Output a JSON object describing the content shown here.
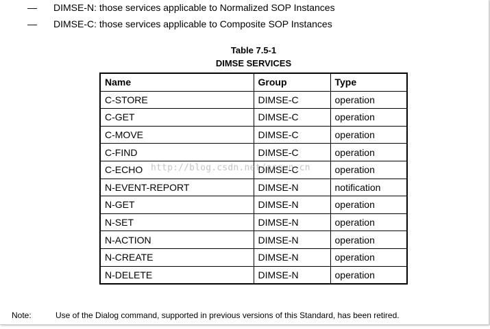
{
  "bullets": [
    {
      "dash": "—",
      "text": "DIMSE-N: those services applicable to Normalized SOP Instances"
    },
    {
      "dash": "—",
      "text": "DIMSE-C: those services applicable to Composite SOP Instances"
    }
  ],
  "table": {
    "caption_line1": "Table 7.5-1",
    "caption_line2": "DIMSE SERVICES",
    "headers": [
      "Name",
      "Group",
      "Type"
    ],
    "rows": [
      [
        "C-STORE",
        "DIMSE-C",
        "operation"
      ],
      [
        "C-GET",
        "DIMSE-C",
        "operation"
      ],
      [
        "C-MOVE",
        "DIMSE-C",
        "operation"
      ],
      [
        "C-FIND",
        "DIMSE-C",
        "operation"
      ],
      [
        "C-ECHO",
        "DIMSE-C",
        "operation"
      ],
      [
        "N-EVENT-REPORT",
        "DIMSE-N",
        "notification"
      ],
      [
        "N-GET",
        "DIMSE-N",
        "operation"
      ],
      [
        "N-SET",
        "DIMSE-N",
        "operation"
      ],
      [
        "N-ACTION",
        "DIMSE-N",
        "operation"
      ],
      [
        "N-CREATE",
        "DIMSE-N",
        "operation"
      ],
      [
        "N-DELETE",
        "DIMSE-N",
        "operation"
      ]
    ]
  },
  "watermark": "http://blog.csdn.net/assun.cn",
  "note": {
    "label": "Note:",
    "text": "Use of the Dialog command, supported in previous  versions of this Standard, has been retired."
  }
}
